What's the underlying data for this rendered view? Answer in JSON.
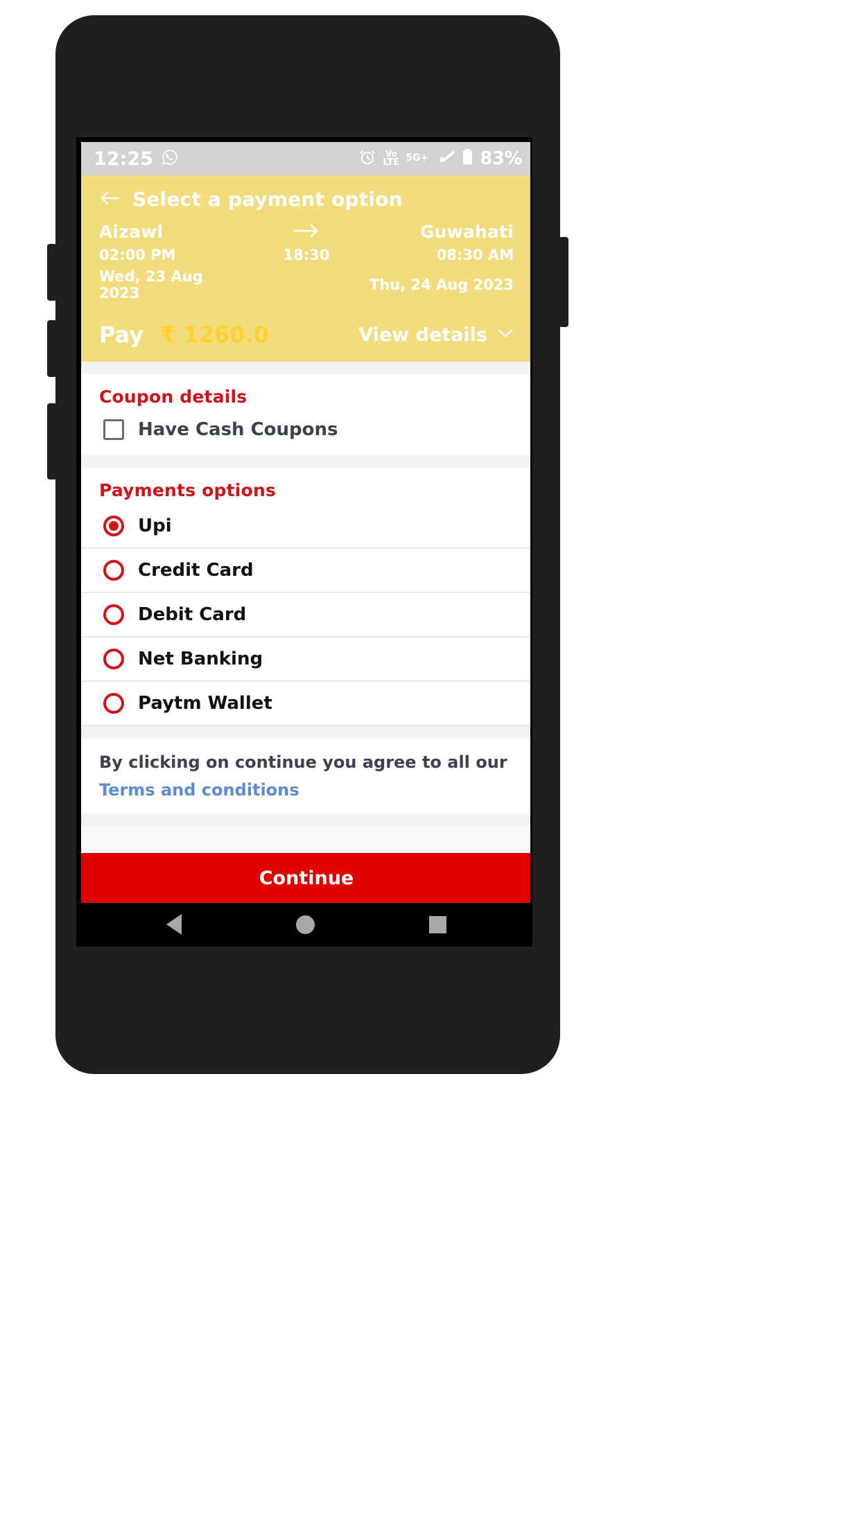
{
  "status_bar": {
    "time": "12:25",
    "whatsapp_icon": "whatsapp-icon",
    "alarm_icon": "alarm-clock-icon",
    "volte_top": "Vo",
    "volte_bottom": "LTE",
    "network": "5G+",
    "roaming": "R",
    "battery_percent": "83%"
  },
  "header": {
    "back_icon": "back-arrow-icon",
    "title": "Select a payment option",
    "origin_city": "Aizawl",
    "destination_city": "Guwahati",
    "depart_time": "02:00 PM",
    "arrive_time": "08:30 AM",
    "duration": "18:30",
    "depart_date": "Wed, 23 Aug 2023",
    "arrive_date": "Thu, 24 Aug 2023",
    "arrow_icon": "right-arrow-icon",
    "pay_label": "Pay",
    "pay_amount": "₹ 1260.0",
    "view_details_label": "View details",
    "chevron_icon": "chevron-down-icon",
    "bg_color": "#f2dc7e",
    "amount_color": "#ffd02e"
  },
  "coupon": {
    "section_title": "Coupon details",
    "checkbox_label": "Have Cash Coupons",
    "checked": false
  },
  "payments": {
    "section_title": "Payments options",
    "accent_color": "#d11216",
    "options": [
      {
        "label": "Upi",
        "selected": true
      },
      {
        "label": "Credit Card",
        "selected": false
      },
      {
        "label": "Debit Card",
        "selected": false
      },
      {
        "label": "Net Banking",
        "selected": false
      },
      {
        "label": "Paytm Wallet",
        "selected": false
      }
    ]
  },
  "terms": {
    "text": "By clicking on continue you agree to all our",
    "link": "Terms and conditions",
    "link_color": "#5b8bd4"
  },
  "footer": {
    "continue_label": "Continue",
    "continue_color": "#e10000"
  },
  "navbar": {
    "back_icon": "nav-back-triangle-icon",
    "home_icon": "nav-home-circle-icon",
    "recents_icon": "nav-recents-square-icon"
  }
}
